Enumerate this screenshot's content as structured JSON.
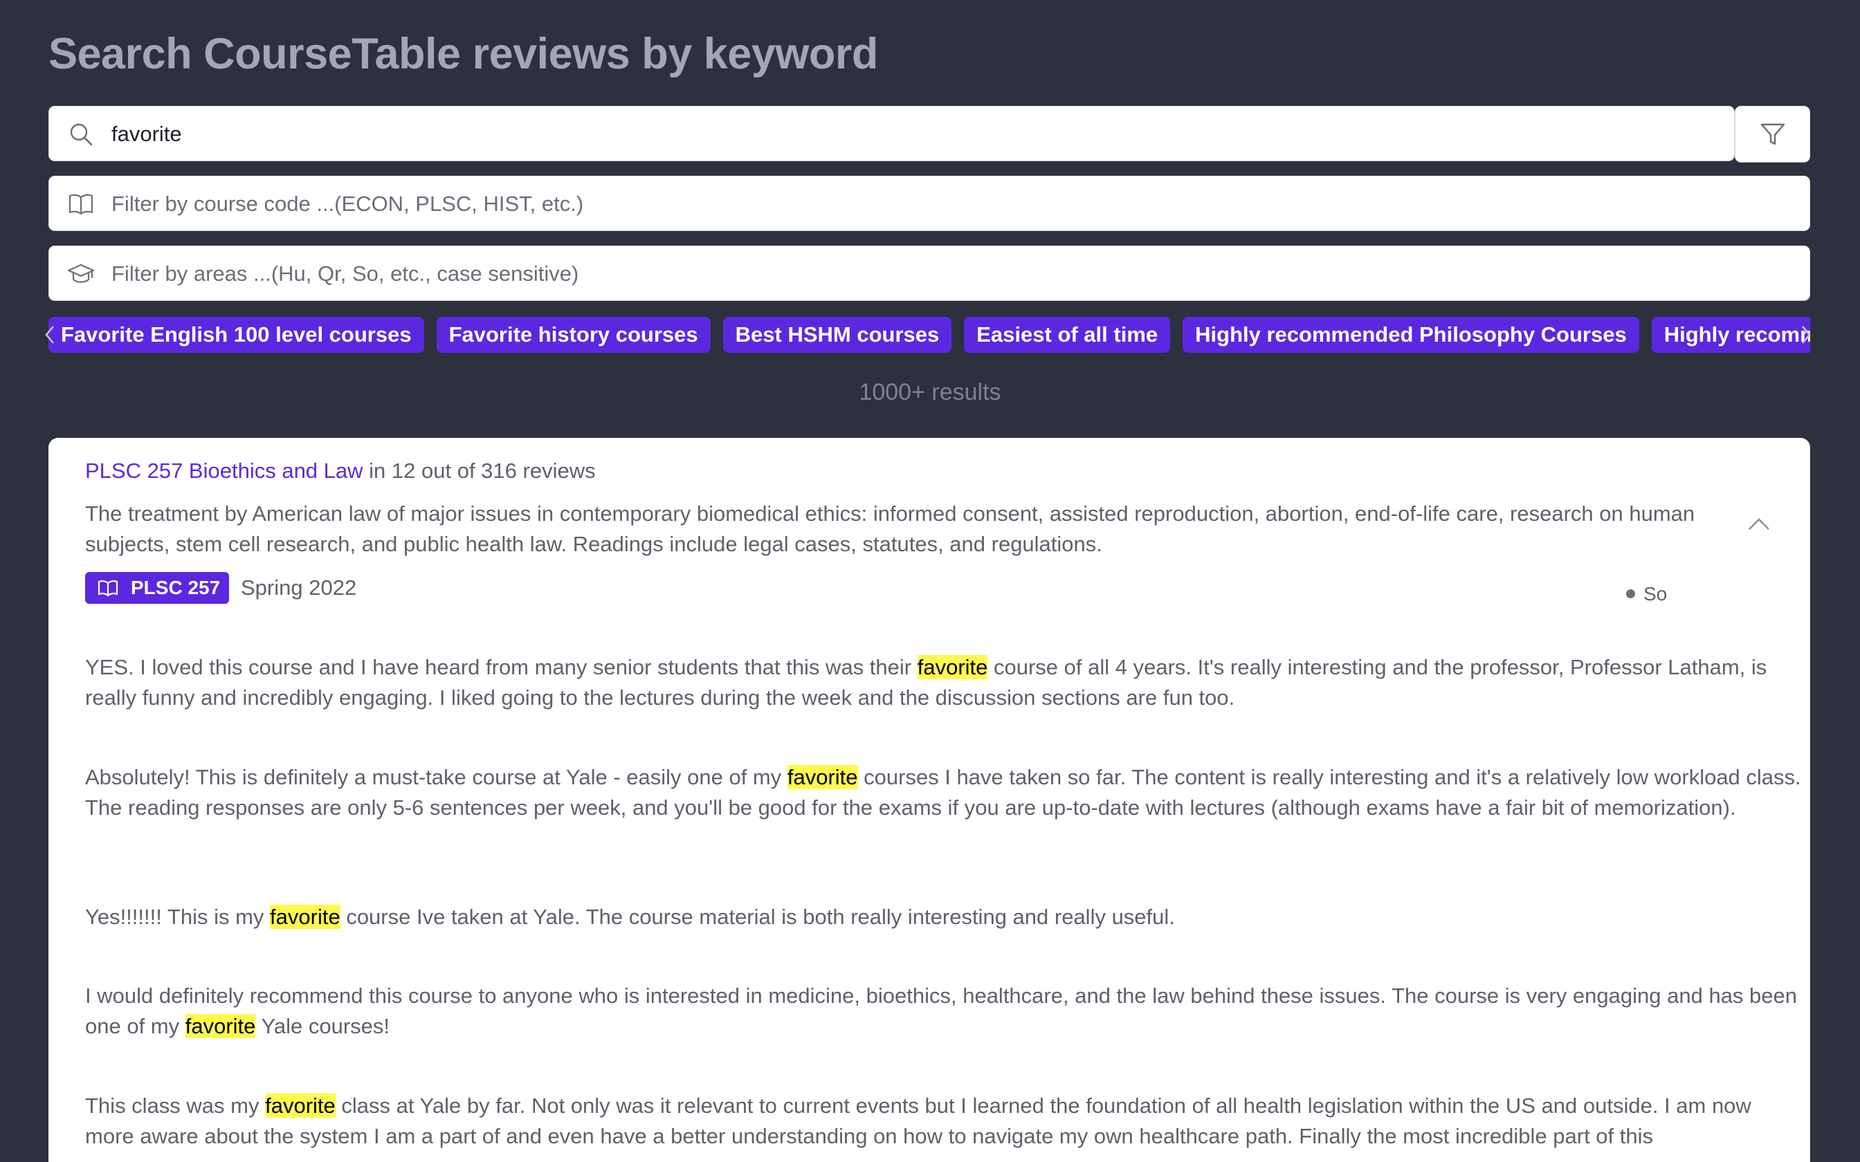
{
  "page": {
    "title": "Search CourseTable reviews by keyword"
  },
  "search": {
    "value": "favorite",
    "icon": "search-icon"
  },
  "filters": {
    "course_code_placeholder": "Filter by course code ...(ECON, PLSC, HIST, etc.)",
    "areas_placeholder": "Filter by areas ...(Hu, Qr, So, etc., case sensitive)",
    "filter_button_icon": "filter-icon"
  },
  "chips": [
    "Favorite English 100 level courses",
    "Favorite history courses",
    "Best HSHM courses",
    "Easiest of all time",
    "Highly recommended Philosophy Courses",
    "Highly recommended"
  ],
  "results": {
    "count_label": "1000+ results"
  },
  "card": {
    "course_link": "PLSC 257 Bioethics and Law",
    "match_info": " in 12 out of 316 reviews",
    "description": "The treatment by American law of major issues in contemporary biomedical ethics: informed consent, assisted reproduction, abortion, end-of-life care, research on human subjects, stem cell research, and public health law. Readings include legal cases, statutes, and regulations.",
    "badge_code": "PLSC 257",
    "term": "Spring 2022",
    "area": "So",
    "highlight_word": "favorite",
    "reviews": [
      {
        "before": "YES. I loved this course and I have heard from many senior students that this was their ",
        "match": "favorite",
        "after": " course of all 4 years. It's really interesting and the professor, Professor Latham, is really funny and incredibly engaging. I liked going to the lectures during the week and the discussion sections are fun too."
      },
      {
        "before": "Absolutely! This is definitely a must-take course at Yale - easily one of my ",
        "match": "favorite",
        "after": " courses I have taken so far. The content is really interesting and it's a relatively low workload class. The reading responses are only 5-6 sentences per week, and you'll be good for the exams if you are up-to-date with lectures (although exams have a fair bit of memorization)."
      },
      {
        "before": "Yes!!!!!!! This is my ",
        "match": "favorite",
        "after": " course Ive taken at Yale. The course material is both really interesting and really useful."
      },
      {
        "before": "I would definitely recommend this course to anyone who is interested in medicine, bioethics, healthcare, and the law behind these issues. The course is very engaging and has been one of my ",
        "match": "favorite",
        "after": " Yale courses!"
      },
      {
        "before": "This class was my ",
        "match": "favorite",
        "after": " class at Yale by far. Not only was it relevant to current events but I learned the foundation of all health legislation within the US and outside. I am now more aware about the system I am a part of and even have a better understanding on how to navigate my own healthcare path. Finally the most incredible part of this"
      }
    ]
  },
  "colors": {
    "background": "#2d303d",
    "accent": "#5b28e0",
    "highlight": "#fff94e"
  }
}
